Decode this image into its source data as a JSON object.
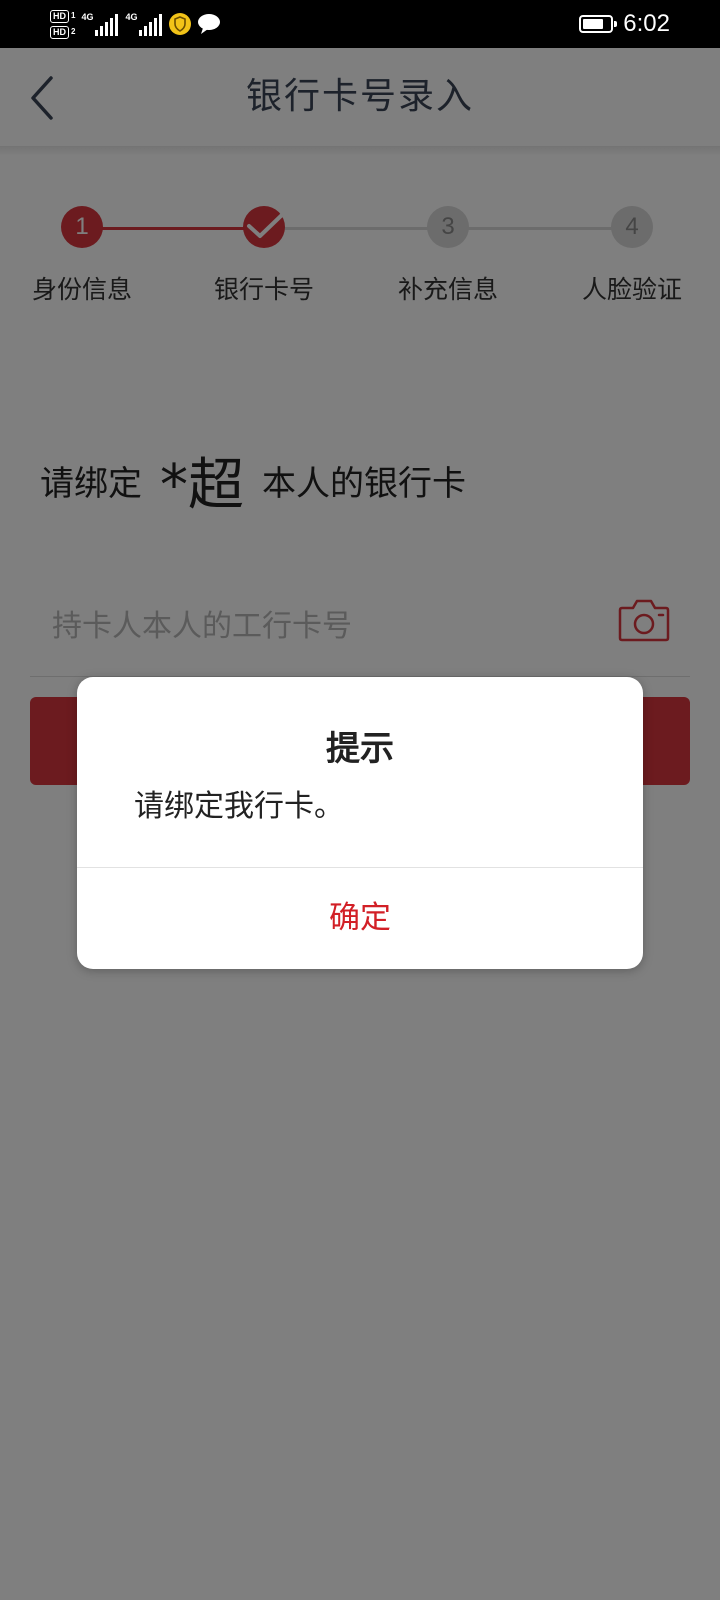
{
  "status_bar": {
    "sim1_badge": "HD",
    "sim1_slot": "1",
    "sim2_badge": "HD",
    "sim2_slot": "2",
    "network1": "4G",
    "network2": "4G",
    "time": "6:02",
    "icons": [
      "hd-badge-icon",
      "signal-icon",
      "shield-app-icon",
      "chat-bubble-icon",
      "battery-icon"
    ]
  },
  "header": {
    "title": "银行卡号录入",
    "back_icon": "chevron-left-icon"
  },
  "steps": [
    {
      "number": "1",
      "label": "身份信息",
      "state": "active"
    },
    {
      "number": "",
      "label": "银行卡号",
      "state": "current-checked"
    },
    {
      "number": "3",
      "label": "补充信息",
      "state": "todo"
    },
    {
      "number": "4",
      "label": "人脸验证",
      "state": "todo"
    }
  ],
  "main": {
    "bind_prefix": "请绑定",
    "bind_name": "*超",
    "bind_suffix": "本人的银行卡",
    "card_input": {
      "value": "",
      "placeholder": "持卡人本人的工行卡号",
      "camera_icon": "camera-icon"
    }
  },
  "dialog": {
    "title": "提示",
    "message": "请绑定我行卡。",
    "confirm_label": "确定"
  },
  "colors": {
    "accent": "#d9363e",
    "confirm_text": "#d21f26",
    "inactive": "#d8d8d8",
    "overlay": "rgba(0,0,0,0.5)"
  }
}
